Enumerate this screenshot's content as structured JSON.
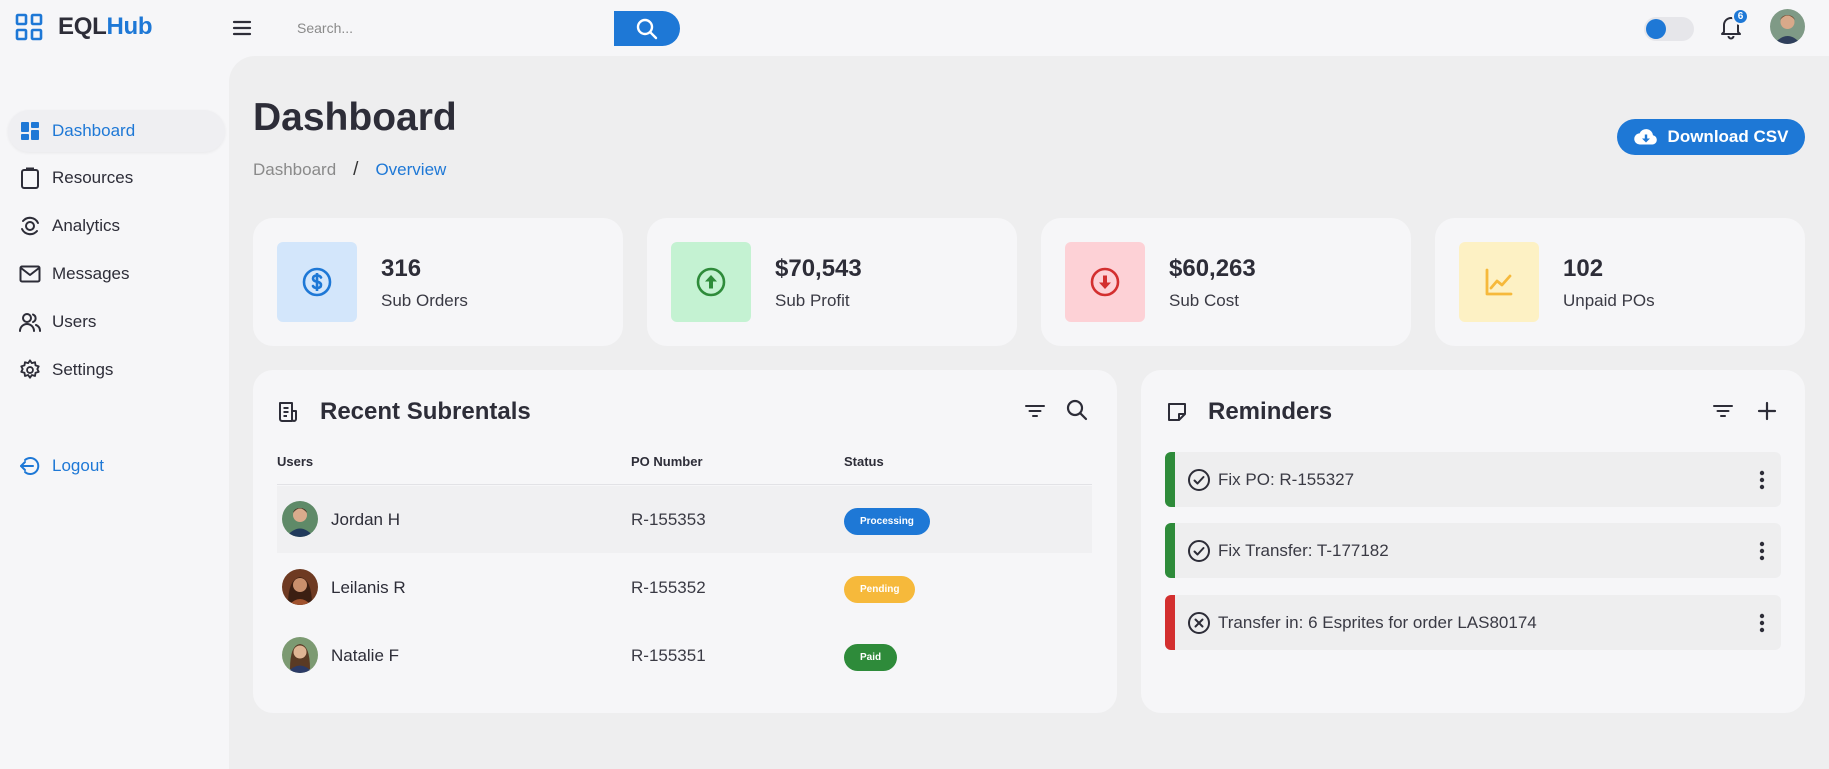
{
  "brand": {
    "name_part1": "EQL",
    "name_part2": "Hub"
  },
  "colors": {
    "accent": "#1e78d6",
    "success": "#2e8b3a",
    "warning": "#f6b93b",
    "danger": "#d32f2f"
  },
  "search": {
    "placeholder": "Search..."
  },
  "notifications": {
    "count": "6"
  },
  "sidebar": {
    "items": [
      {
        "label": "Dashboard",
        "icon": "dashboard-icon",
        "active": true
      },
      {
        "label": "Resources",
        "icon": "clipboard-icon"
      },
      {
        "label": "Analytics",
        "icon": "analytics-icon"
      },
      {
        "label": "Messages",
        "icon": "mail-icon"
      },
      {
        "label": "Users",
        "icon": "users-icon"
      },
      {
        "label": "Settings",
        "icon": "gear-icon"
      }
    ],
    "logout": "Logout"
  },
  "header": {
    "title": "Dashboard",
    "breadcrumb": [
      "Dashboard",
      "/",
      "Overview"
    ],
    "download_label": "Download CSV"
  },
  "stats": [
    {
      "value": "316",
      "label": "Sub Orders",
      "icon": "dollar-icon"
    },
    {
      "value": "$70,543",
      "label": "Sub Profit",
      "icon": "arrow-up-circle-icon"
    },
    {
      "value": "$60,263",
      "label": "Sub Cost",
      "icon": "arrow-down-circle-icon"
    },
    {
      "value": "102",
      "label": "Unpaid POs",
      "icon": "chart-line-icon"
    }
  ],
  "subrentals": {
    "title": "Recent Subrentals",
    "columns": [
      "Users",
      "PO Number",
      "Status"
    ],
    "rows": [
      {
        "name": "Jordan H",
        "po": "R-155353",
        "status": "Processing"
      },
      {
        "name": "Leilanis R",
        "po": "R-155352",
        "status": "Pending"
      },
      {
        "name": "Natalie F",
        "po": "R-155351",
        "status": "Paid"
      }
    ]
  },
  "reminders": {
    "title": "Reminders",
    "items": [
      {
        "text": "Fix PO: R-155327",
        "state": "done"
      },
      {
        "text": "Fix Transfer: T-177182",
        "state": "done"
      },
      {
        "text": "Transfer in: 6 Esprites for order LAS80174",
        "state": "failed"
      }
    ]
  }
}
